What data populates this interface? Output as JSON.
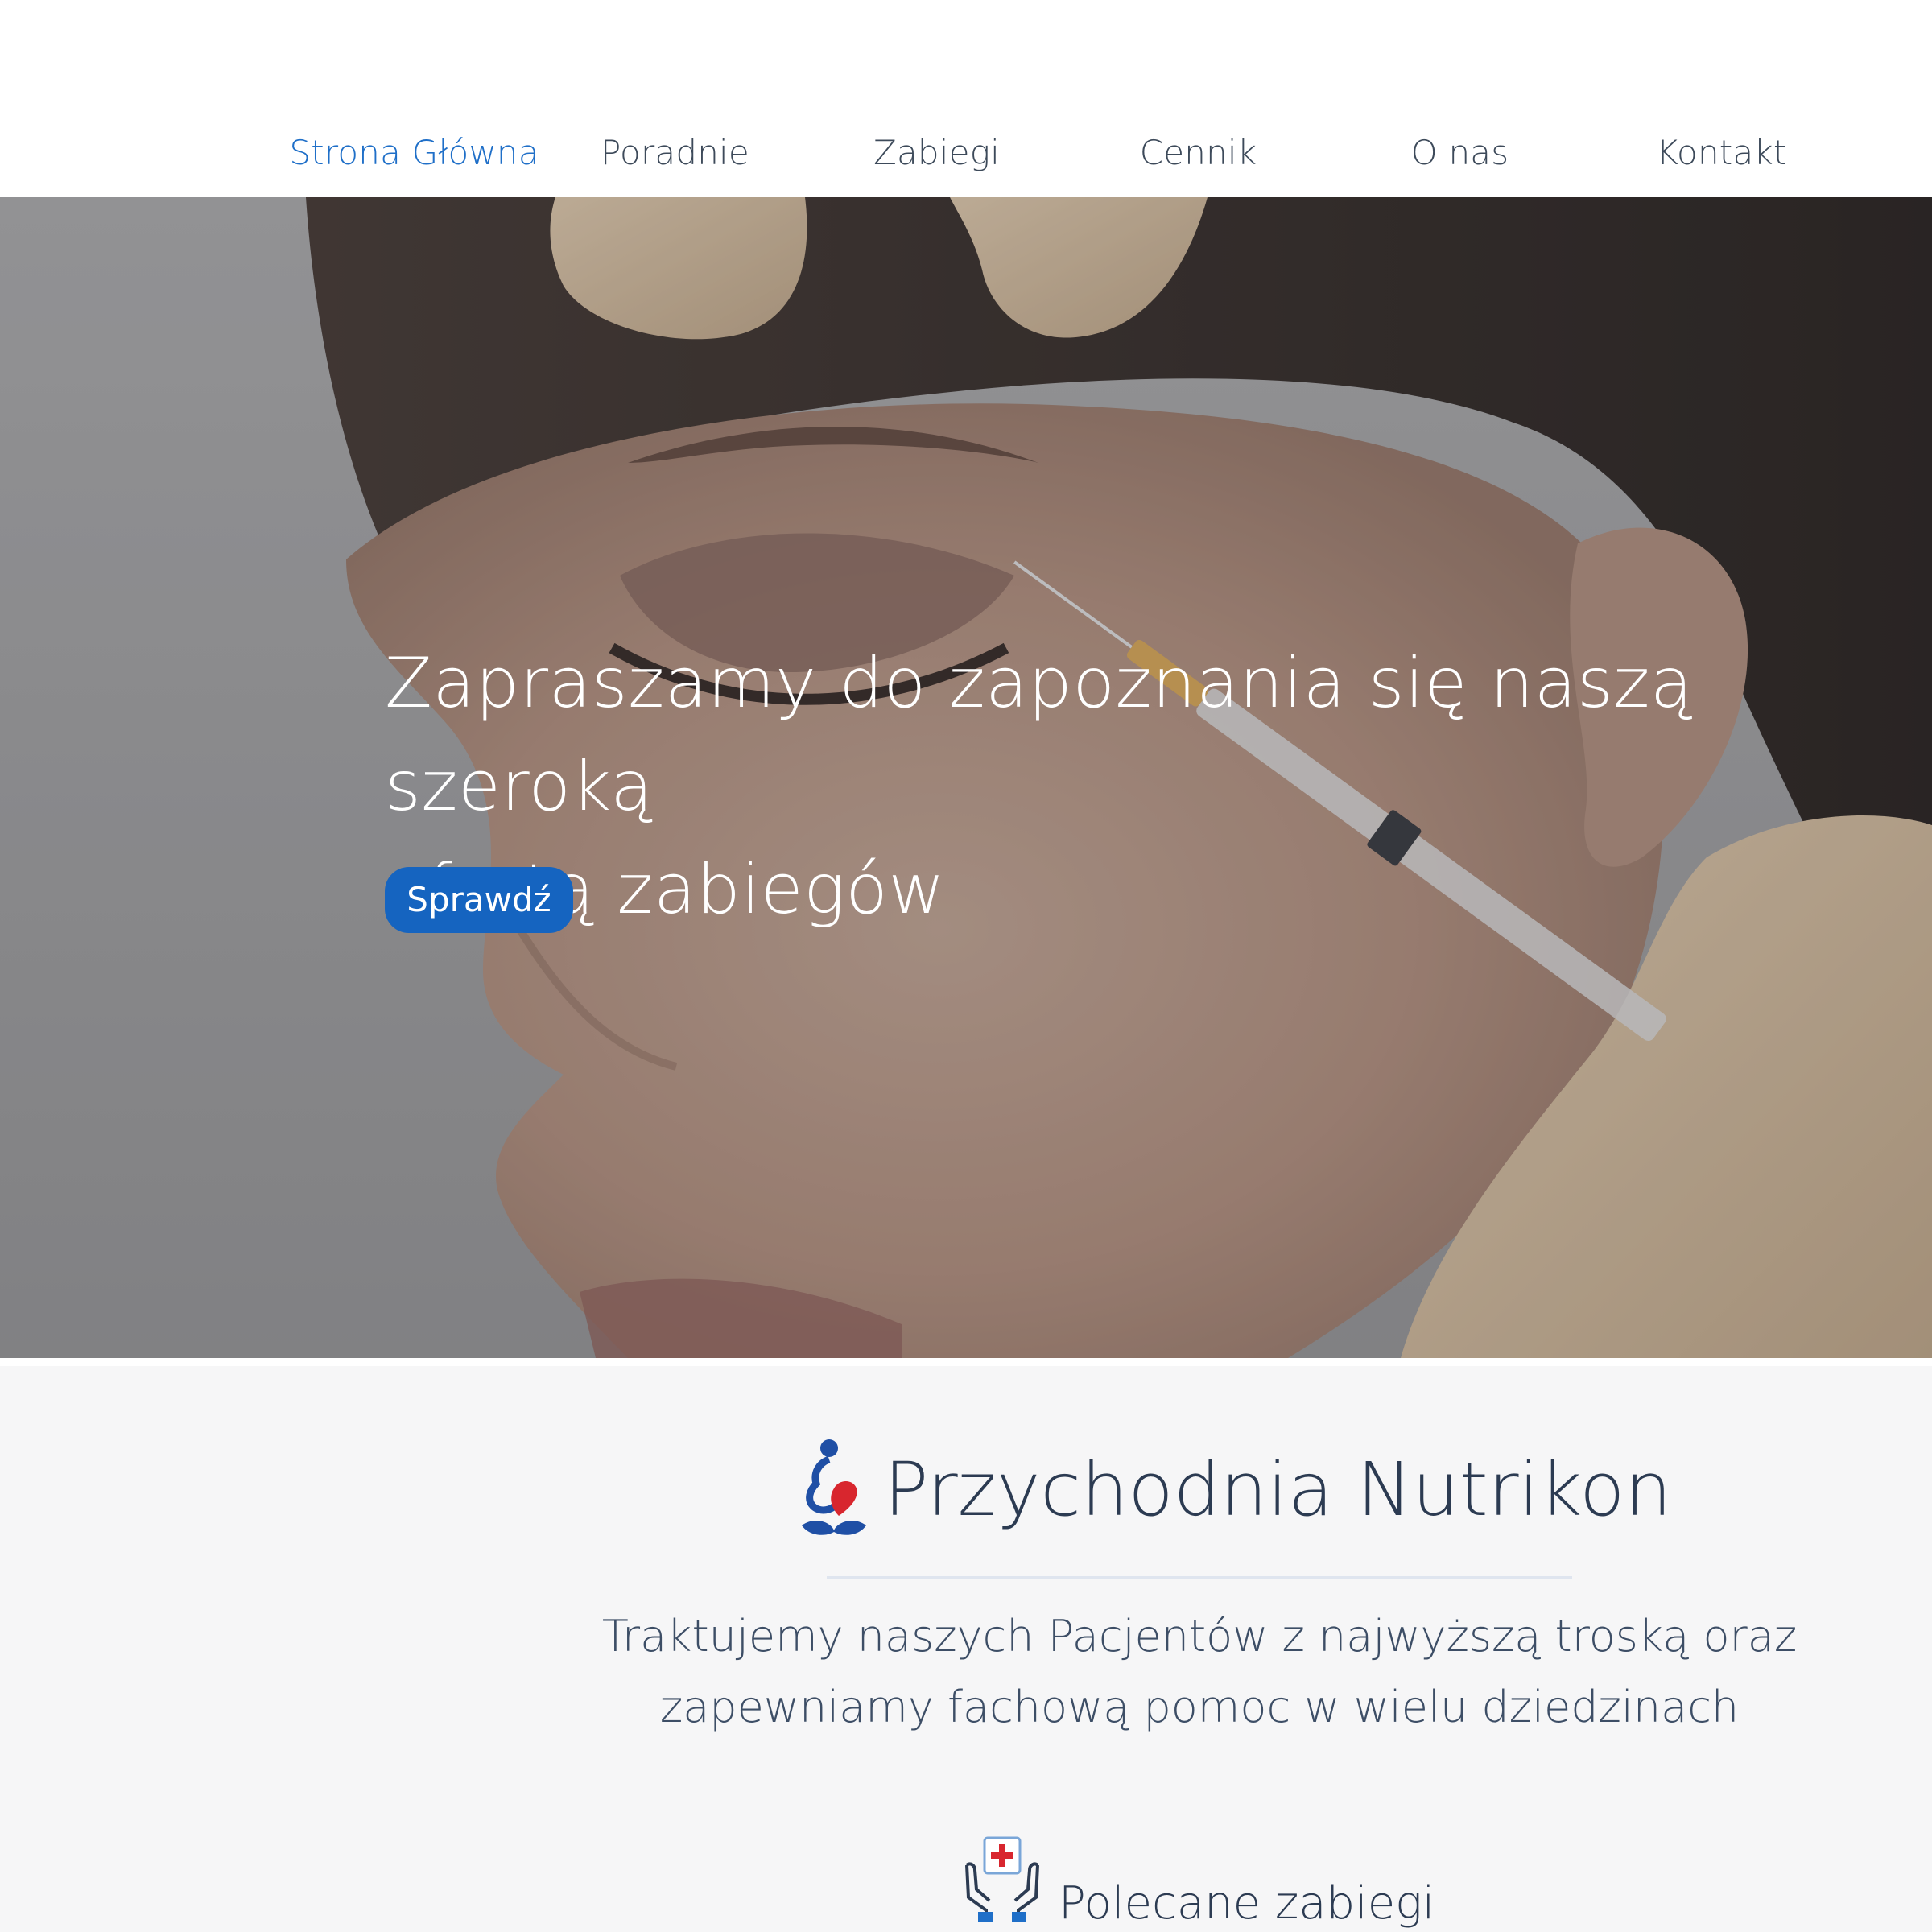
{
  "nav": {
    "items": [
      {
        "label": "Strona Główna",
        "active": true
      },
      {
        "label": "Poradnie",
        "active": false
      },
      {
        "label": "Zabiegi",
        "active": false
      },
      {
        "label": "Cennik",
        "active": false
      },
      {
        "label": "O nas",
        "active": false
      },
      {
        "label": "Kontakt",
        "active": false
      }
    ]
  },
  "hero": {
    "title_line1": "Zapraszamy do zapoznania się naszą szeroką",
    "title_line2": "ofertą zabiegów",
    "button_label": "Sprawdź"
  },
  "about": {
    "brand_name": "Przychodnia Nutrikon",
    "tagline_line1": "Traktujemy naszych Pacjentów z najwyższą troską oraz",
    "tagline_line2": "zapewniamy fachową pomoc w wielu dziedzinach",
    "featured_label": "Polecane zabiegi",
    "logo_icon": "clinic-logo-icon",
    "featured_icon": "medical-hands-icon"
  },
  "colors": {
    "accent": "#1f6fc8",
    "button": "#1564c0",
    "text_dark": "#2c3b52",
    "nav_text": "#3d4a5a",
    "section_bg": "#f6f6f7"
  }
}
